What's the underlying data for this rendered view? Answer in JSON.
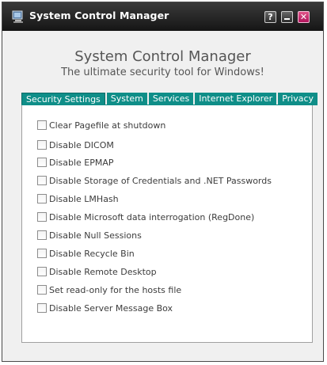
{
  "window": {
    "title": "System Control Manager",
    "buttons": {
      "help": "?",
      "close": "✕"
    }
  },
  "header": {
    "title": "System Control Manager",
    "subtitle": "The ultimate security tool for Windows!"
  },
  "tabs": [
    {
      "label": "Security Settings",
      "active": true
    },
    {
      "label": "System",
      "active": false
    },
    {
      "label": "Services",
      "active": false
    },
    {
      "label": "Internet Explorer",
      "active": false
    },
    {
      "label": "Privacy",
      "active": false
    }
  ],
  "options": [
    {
      "label": "Clear Pagefile at shutdown",
      "checked": false
    },
    {
      "label": "Disable DICOM",
      "checked": false
    },
    {
      "label": "Disable EPMAP",
      "checked": false
    },
    {
      "label": "Disable Storage of Credentials and .NET Passwords",
      "checked": false
    },
    {
      "label": "Disable LMHash",
      "checked": false
    },
    {
      "label": "Disable Microsoft data interrogation (RegDone)",
      "checked": false
    },
    {
      "label": "Disable Null Sessions",
      "checked": false
    },
    {
      "label": "Disable Recycle Bin",
      "checked": false
    },
    {
      "label": "Disable Remote Desktop",
      "checked": false
    },
    {
      "label": "Set read-only for the hosts file",
      "checked": false
    },
    {
      "label": "Disable Server Message Box",
      "checked": false
    }
  ],
  "colors": {
    "tab_accent": "#0f8e88",
    "titlebar": "#1c1c1c",
    "close_button": "#c81e6e"
  }
}
